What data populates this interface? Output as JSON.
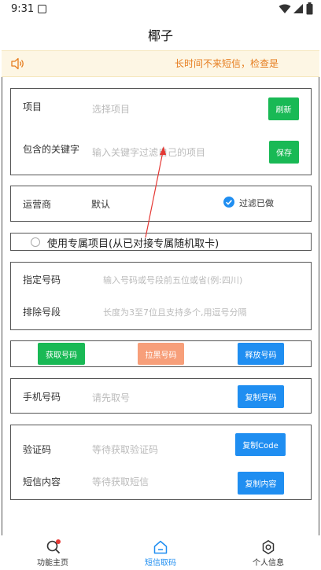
{
  "status": {
    "time": "9:31"
  },
  "appbar": {
    "title": "椰子"
  },
  "notice": {
    "text": "长时间不来短信，检查是"
  },
  "project": {
    "label": "项目",
    "placeholder": "选择项目",
    "refresh_label": "刷新",
    "keyword_label": "包含的关键字",
    "keyword_placeholder": "输入关键字过滤自己的项目",
    "save_label": "保存"
  },
  "operator": {
    "label": "运营商",
    "value": "默认",
    "filter_label": "过滤已做"
  },
  "exclusive": {
    "label": "使用专属项目(从已对接专属随机取卡)"
  },
  "numbers": {
    "specify_label": "指定号码",
    "specify_placeholder": "输入号码或号段前五位或省(例:四川)",
    "exclude_label": "排除号段",
    "exclude_placeholder": "长度为3至7位且支持多个,用逗号分隔"
  },
  "actions": {
    "get": "获取号码",
    "block": "拉黑号码",
    "release": "释放号码"
  },
  "phone": {
    "label": "手机号码",
    "placeholder": "请先取号",
    "copy_label": "复制号码"
  },
  "sms": {
    "code_label": "验证码",
    "code_placeholder": "等待获取验证码",
    "copy_code_label": "复制Code",
    "content_label": "短信内容",
    "content_placeholder": "等待获取短信",
    "copy_content_label": "复制内容"
  },
  "tabs": [
    {
      "label": "功能主页",
      "icon": "search-icon"
    },
    {
      "label": "短信取码",
      "icon": "home-icon"
    },
    {
      "label": "个人信息",
      "icon": "gear-icon"
    }
  ],
  "colors": {
    "accent_blue": "#1f8ef1",
    "green": "#19b955",
    "orange_button": "#f79f7a",
    "notice_text": "#e67d1f",
    "notice_bg": "#fdf6e4"
  }
}
